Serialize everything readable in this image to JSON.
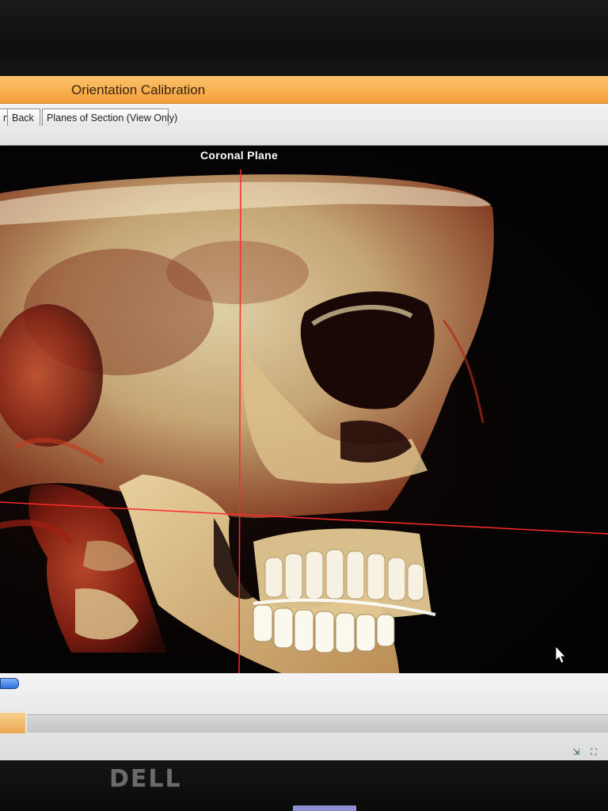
{
  "window": {
    "title": "Orientation Calibration"
  },
  "toolbar": {
    "partial_tab_label": "n",
    "back_label": "Back",
    "planes_label": "Planes of Section (View Only)"
  },
  "viewport": {
    "plane_label": "Coronal Plane"
  },
  "monitor": {
    "brand": "DELL"
  },
  "colors": {
    "titlebar": "#f5a03a",
    "crosshair": "#ff2a2a",
    "bone": "#e9d6a6",
    "tissue": "#9a2a18",
    "background": "#060304"
  },
  "icons": {
    "cursor": "mouse-pointer",
    "tray": [
      "expand-icon",
      "network-icon"
    ]
  }
}
